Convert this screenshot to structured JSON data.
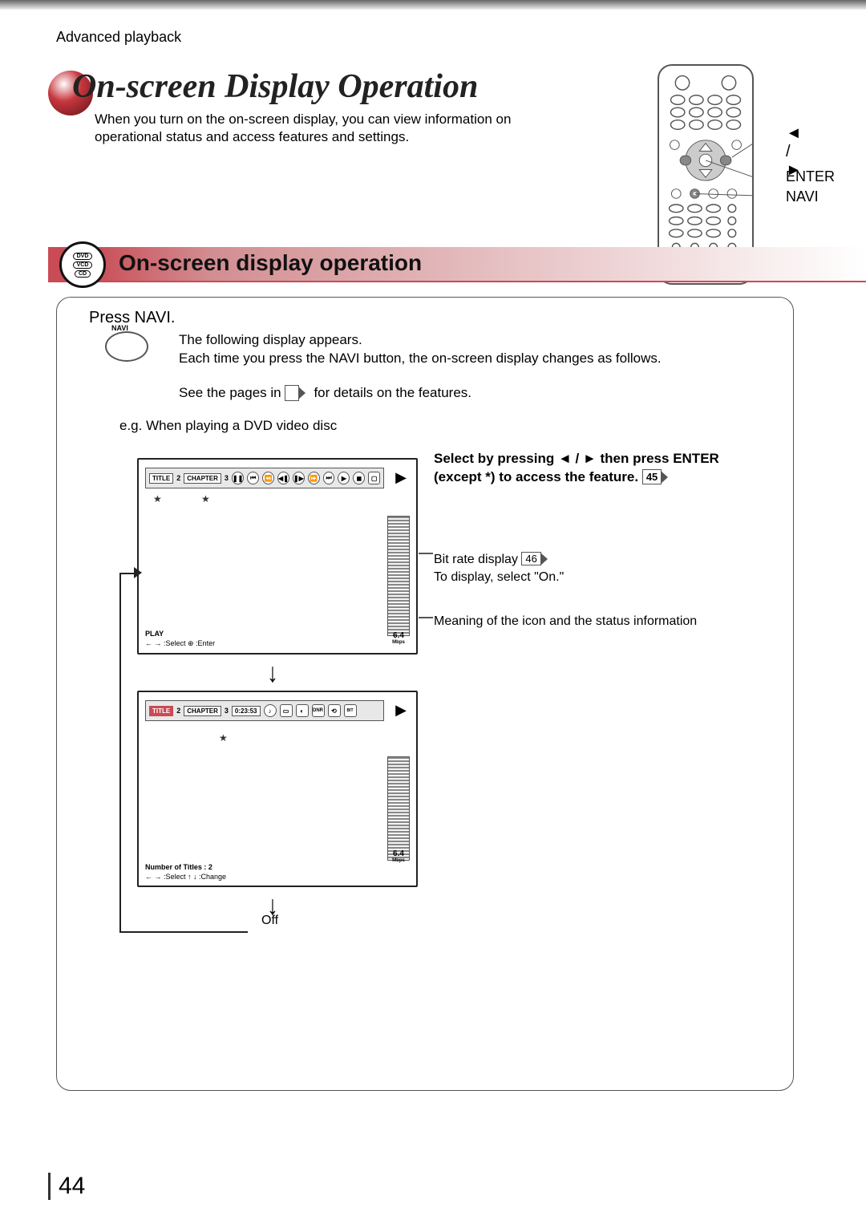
{
  "breadcrumb": "Advanced playback",
  "pageTitle": "On-screen Display Operation",
  "pageSubtitle": "When you turn on the on-screen display, you can view information on operational status and access features and settings.",
  "remoteLabels": {
    "arrows": "◄ / ►",
    "enter": "ENTER",
    "navi": "NAVI"
  },
  "discTypes": {
    "a": "DVD",
    "b": "VCD",
    "c": "CD"
  },
  "sectionTitle": "On-screen display operation",
  "stepTitle": "Press NAVI.",
  "naviBtn": "NAVI",
  "body1a": "The following display appears.",
  "body1b": "Each time you press the NAVI button, the on-screen display changes as follows.",
  "body2_pre": "See the pages in ",
  "body2_post": " for details on the features.",
  "exampleLine": "e.g. When playing a DVD video disc",
  "instruct_pre": "Select by pressing ◄ / ► then press ENTER (except *) to access the feature. ",
  "instruct_ref": "45",
  "bitrate_label_pre": "Bit rate display ",
  "bitrate_label_ref": "46",
  "bitrate_note": "To display, select \"On.\"",
  "meaning_note": "Meaning of the icon and the status information",
  "offLabel": "Off",
  "pageNumber": "44",
  "screen1": {
    "title_label": "TITLE",
    "title_val": "2",
    "chapter_label": "CHAPTER",
    "chapter_val": "3",
    "footer_main": "PLAY",
    "footer_hint": "← → :Select   ⊕ :Enter",
    "bitrate_val": "6.4",
    "bitrate_unit": "Mbps"
  },
  "screen2": {
    "title_label": "TITLE",
    "title_val": "2",
    "chapter_label": "CHAPTER",
    "chapter_val": "3",
    "time": "0:23:53",
    "footer_main": "Number of Titles :   2",
    "footer_hint": "← → :Select   ↑ ↓ :Change",
    "bitrate_val": "6.4",
    "bitrate_unit": "Mbps"
  }
}
